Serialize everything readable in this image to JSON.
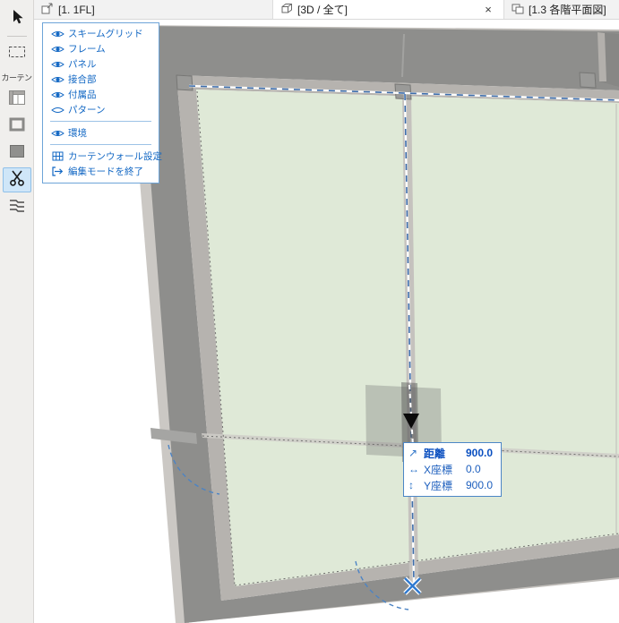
{
  "tabs": {
    "items": [
      {
        "label": "[1. 1FL]"
      },
      {
        "label": "[3D / 全て]"
      },
      {
        "label": "[1.3 各階平面図]"
      }
    ],
    "close_glyph": "×"
  },
  "toolbar": {
    "group_label": "カーテン",
    "tools": [
      "select",
      "marquee",
      "scheme-grid",
      "frame",
      "panel",
      "scissors",
      "profiles"
    ],
    "selected_tool": "scissors"
  },
  "view_options_menu": {
    "items": [
      {
        "label": "スキームグリッド",
        "visible": true
      },
      {
        "label": "フレーム",
        "visible": true
      },
      {
        "label": "パネル",
        "visible": true
      },
      {
        "label": "接合部",
        "visible": true
      },
      {
        "label": "付属品",
        "visible": true
      },
      {
        "label": "パターン",
        "visible": false
      },
      {
        "label": "環境",
        "visible": true
      },
      {
        "label": "カーテンウォール設定"
      },
      {
        "label": "編集モードを終了"
      }
    ]
  },
  "tracker": {
    "rows": [
      {
        "glyph": "↗",
        "label": "距離",
        "value": "900.0"
      },
      {
        "glyph": "↔",
        "label": "X座標",
        "value": "0.0"
      },
      {
        "glyph": "↕",
        "label": "Y座標",
        "value": "900.0"
      }
    ]
  },
  "colors": {
    "accent_blue": "#1368c4",
    "selection_blue": "#3d6dab",
    "glass_green": "#dfe9d7",
    "wall_gray": "#8e8e8c",
    "frame_gray": "#b6b3af"
  }
}
